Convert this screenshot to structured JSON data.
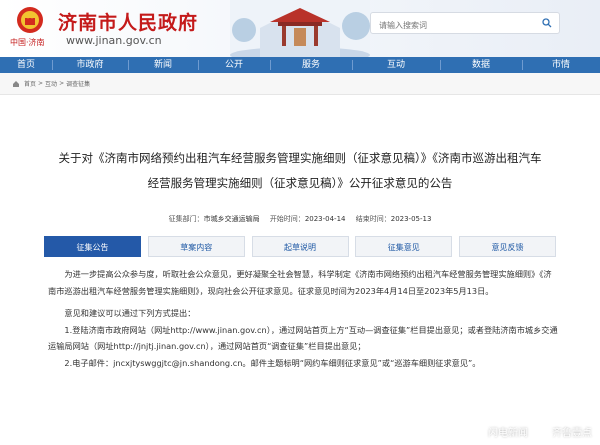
{
  "header": {
    "site_title": "济南市人民政府",
    "site_url": "www.jinan.gov.cn",
    "sub_brand": "中国·济南",
    "search_placeholder": "请输入搜索词"
  },
  "nav": {
    "items": [
      "首页",
      "市政府",
      "新闻",
      "公开",
      "服务",
      "互动",
      "数据",
      "市情"
    ]
  },
  "breadcrumb": {
    "items": [
      "首页",
      "互动",
      "调查征集"
    ]
  },
  "article": {
    "title_line1": "关于对《济南市网络预约出租汽车经营服务管理实施细则（征求意见稿）》《济南市巡游出租汽车",
    "title_line2": "经营服务管理实施细则（征求意见稿）》公开征求意见的公告",
    "meta": {
      "dept_label": "征集部门：",
      "dept_value": "市城乡交通运输局",
      "start_label": "开始时间：",
      "start_value": "2023-04-14",
      "end_label": "结束时间：",
      "end_value": "2023-05-13"
    }
  },
  "tabs": [
    "征集公告",
    "草案内容",
    "起草说明",
    "征集意见",
    "意见反馈"
  ],
  "body": {
    "p1": "为进一步提高公众参与度，听取社会公众意见，更好凝聚全社会智慧，科学制定《济南市网络预约出租汽车经营服务管理实施细则》《济南市巡游出租汽车经营服务管理实施细则》，现向社会公开征求意见。征求意见时间为2023年4月14日至2023年5月13日。",
    "p2": "意见和建议可以通过下列方式提出：",
    "p3": "1.登陆济南市政府网站（网址http://www.jinan.gov.cn），通过网站首页上方“互动—调查征集”栏目提出意见；或者登陆济南市城乡交通运输局网站（网址http://jnjtj.jinan.gov.cn），通过网站首页“调查征集”栏目提出意见；",
    "p4": "2.电子邮件：jncxjtyswggjtc@jn.shandong.cn。邮件主题标明“网约车细则征求意见”或“巡游车细则征求意见”。"
  },
  "watermark": {
    "text1": "闪电新闻",
    "text2": "齐鲁壹点"
  },
  "colors": {
    "brand_red": "#c41a1a",
    "nav_blue": "#2f6fb3",
    "tab_active": "#2459a8"
  }
}
